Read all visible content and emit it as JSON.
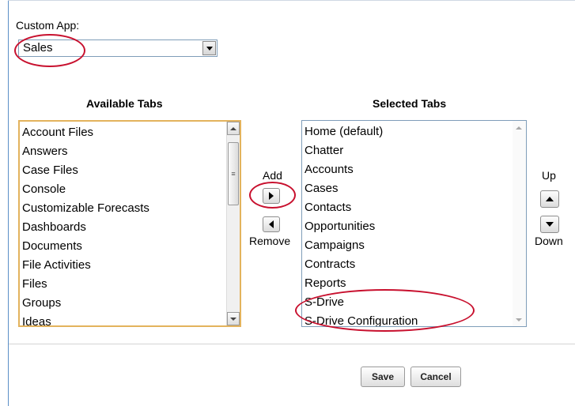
{
  "custom_app": {
    "label": "Custom App:",
    "selected_value": "Sales"
  },
  "available": {
    "heading": "Available Tabs",
    "items": [
      "Account Files",
      "Answers",
      "Case Files",
      "Console",
      "Customizable Forecasts",
      "Dashboards",
      "Documents",
      "File Activities",
      "Files",
      "Groups",
      "Ideas"
    ]
  },
  "selected": {
    "heading": "Selected Tabs",
    "items": [
      "Home (default)",
      "Chatter",
      "Accounts",
      "Cases",
      "Contacts",
      "Opportunities",
      "Campaigns",
      "Contracts",
      "Reports",
      "S-Drive",
      "S-Drive Configuration"
    ]
  },
  "transfer": {
    "add_label": "Add",
    "remove_label": "Remove"
  },
  "order": {
    "up_label": "Up",
    "down_label": "Down"
  },
  "footer": {
    "save_label": "Save",
    "cancel_label": "Cancel"
  },
  "colors": {
    "annotation": "#c8102e",
    "focus_border": "#e3b35d",
    "frame_accent": "#5b8fc7"
  }
}
